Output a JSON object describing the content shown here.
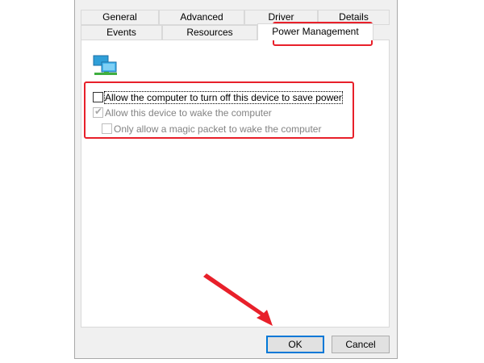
{
  "tabs_row1": [
    "General",
    "Advanced",
    "Driver",
    "Details"
  ],
  "tabs_row2": [
    "Events",
    "Resources",
    "Power Management"
  ],
  "icons": {
    "device": "network-adapter-icon",
    "arrow": "red-arrow-annotation"
  },
  "options": {
    "allow_turn_off": {
      "label": "Allow the computer to turn off this device to save power",
      "checked": false,
      "enabled": true
    },
    "allow_wake": {
      "label": "Allow this device to wake the computer",
      "checked": true,
      "enabled": false
    },
    "magic_packet": {
      "label": "Only allow a magic packet to wake the computer",
      "checked": false,
      "enabled": false
    }
  },
  "buttons": {
    "ok": "OK",
    "cancel": "Cancel"
  },
  "colors": {
    "annotation_red": "#e8202a",
    "default_button_border": "#0078d7"
  }
}
